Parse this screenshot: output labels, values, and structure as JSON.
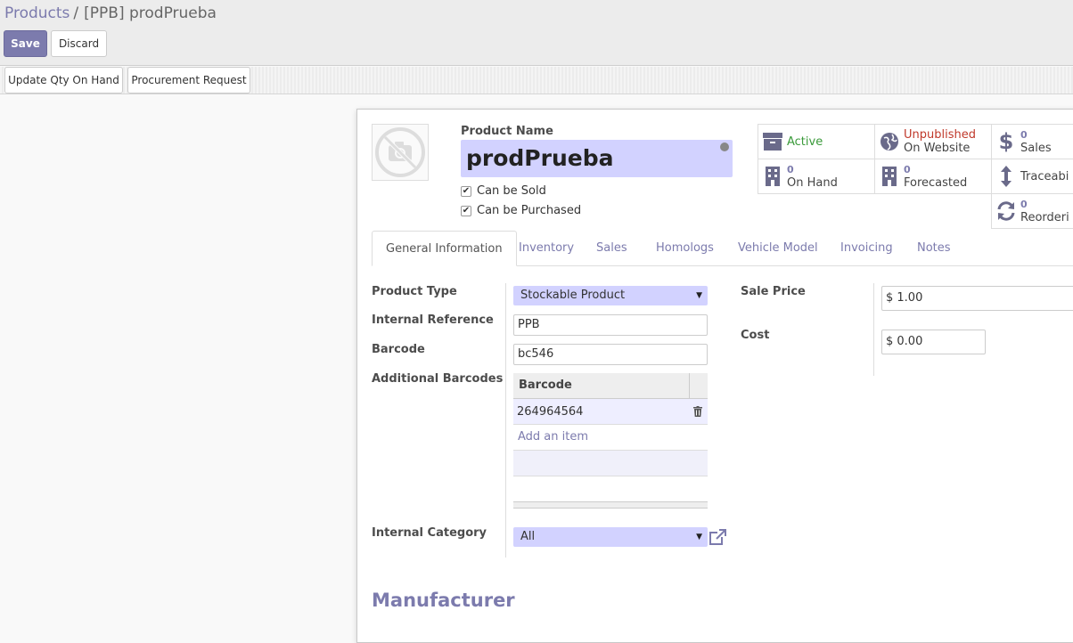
{
  "breadcrumb": {
    "parent": "Products",
    "separator": "/",
    "current": "[PPB] prodPrueba"
  },
  "buttons": {
    "save": "Save",
    "discard": "Discard"
  },
  "statusbar": {
    "update_qty": "Update Qty On Hand",
    "procurement": "Procurement Request"
  },
  "product": {
    "name_label": "Product Name",
    "name": "prodPrueba",
    "can_be_sold_label": "Can be Sold",
    "can_be_sold": true,
    "can_be_purchased_label": "Can be Purchased",
    "can_be_purchased": true
  },
  "smart_buttons": {
    "active": "Active",
    "website_status": "Unpublished",
    "website_label": "On Website",
    "sales_count": "0",
    "sales_label": "Sales",
    "on_hand_count": "0",
    "on_hand_label": "On Hand",
    "forecasted_count": "0",
    "forecasted_label": "Forecasted",
    "traceability_label": "Traceabi",
    "reordering_count": "0",
    "reordering_label": "Reorderi"
  },
  "tabs": [
    "General Information",
    "Inventory",
    "Sales",
    "Homologs",
    "Vehicle Model",
    "Invoicing",
    "Notes"
  ],
  "general": {
    "product_type_label": "Product Type",
    "product_type": "Stockable Product",
    "internal_ref_label": "Internal Reference",
    "internal_ref": "PPB",
    "barcode_label": "Barcode",
    "barcode": "bc546",
    "additional_barcodes_label": "Additional Barcodes",
    "barcodes_column": "Barcode",
    "barcodes_rows": [
      "264964564"
    ],
    "add_item": "Add an item",
    "internal_category_label": "Internal Category",
    "internal_category": "All",
    "sale_price_label": "Sale Price",
    "sale_price": "$ 1.00",
    "cost_label": "Cost",
    "cost": "$ 0.00"
  },
  "section": {
    "manufacturer": "Manufacturer"
  },
  "colors": {
    "primary": "#7c7bad",
    "required_field": "#d2d2ff",
    "active_green": "#3a9a3a",
    "unpublished_red": "#c0392b"
  }
}
